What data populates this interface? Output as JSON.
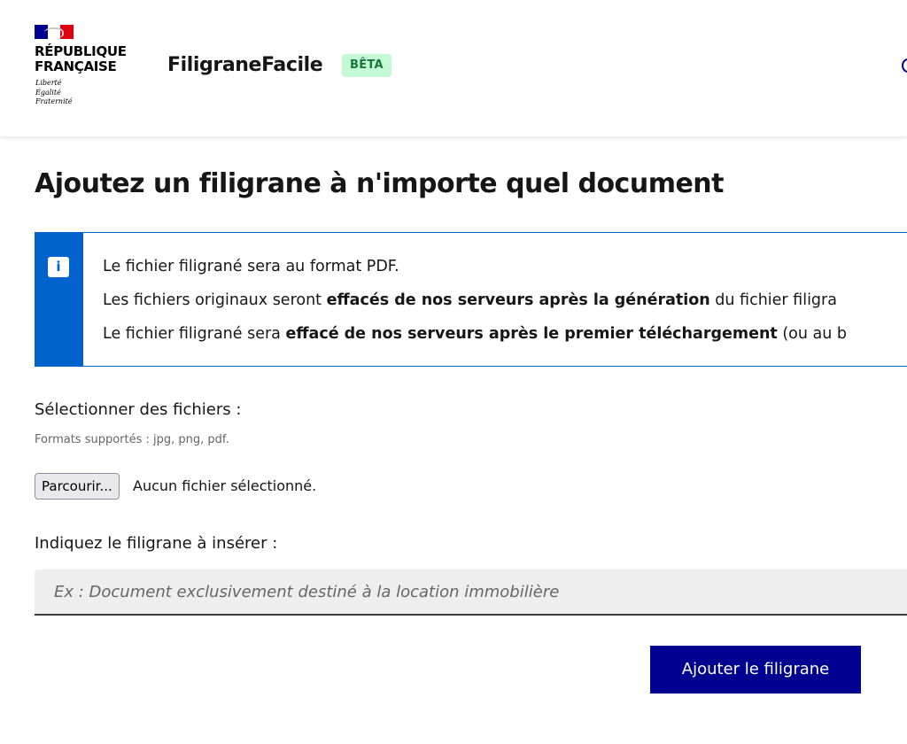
{
  "header": {
    "republic_name_line1": "RÉPUBLIQUE",
    "republic_name_line2": "FRANÇAISE",
    "motto_line1": "Liberté",
    "motto_line2": "Égalité",
    "motto_line3": "Fraternité",
    "site_title": "FiligraneFacile",
    "badge": "BÊTA"
  },
  "main": {
    "title": "Ajoutez un filigrane à n'importe quel document",
    "alert": {
      "line1": "Le fichier filigrané sera au format PDF.",
      "line2_before": "Les fichiers originaux seront ",
      "line2_bold": "effacés de nos serveurs après la génération",
      "line2_after": " du fichier filigra",
      "line3_before": "Le fichier filigrané sera ",
      "line3_bold": "effacé de nos serveurs après le premier téléchargement",
      "line3_after": " (ou au b"
    },
    "files": {
      "label": "Sélectionner des fichiers :",
      "hint": "Formats supportés : jpg, png, pdf.",
      "browse_label": "Parcourir...",
      "status": "Aucun fichier sélectionné."
    },
    "watermark": {
      "label": "Indiquez le filigrane à insérer :",
      "value": "",
      "placeholder": "Ex : Document exclusivement destiné à la location immobilière"
    },
    "submit_label": "Ajouter le filigrane"
  },
  "colors": {
    "brand_blue": "#000091",
    "info_blue": "#0063cb",
    "flag_red": "#e1000f",
    "badge_bg": "#c3fad5",
    "badge_text": "#18753c"
  },
  "icons": {
    "alert": "info-icon",
    "logo": "marianne-flag-icon",
    "header_right": "search-icon"
  }
}
